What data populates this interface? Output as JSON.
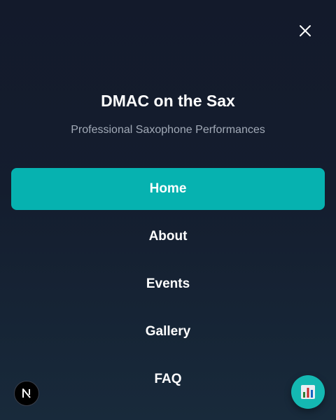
{
  "header": {
    "close_icon": "close-icon"
  },
  "brand": {
    "title": "DMAC on the Sax",
    "subtitle": "Professional Saxophone Performances"
  },
  "nav": {
    "items": [
      {
        "label": "Home",
        "active": true
      },
      {
        "label": "About",
        "active": false
      },
      {
        "label": "Events",
        "active": false
      },
      {
        "label": "Gallery",
        "active": false
      },
      {
        "label": "FAQ",
        "active": false
      }
    ]
  },
  "floating": {
    "left_badge_icon": "nextjs-logo-icon",
    "right_button_icon": "bar-chart-icon"
  },
  "colors": {
    "accent": "#06b2b0",
    "background": "#141b2c",
    "subtitle": "#a2aab7"
  }
}
